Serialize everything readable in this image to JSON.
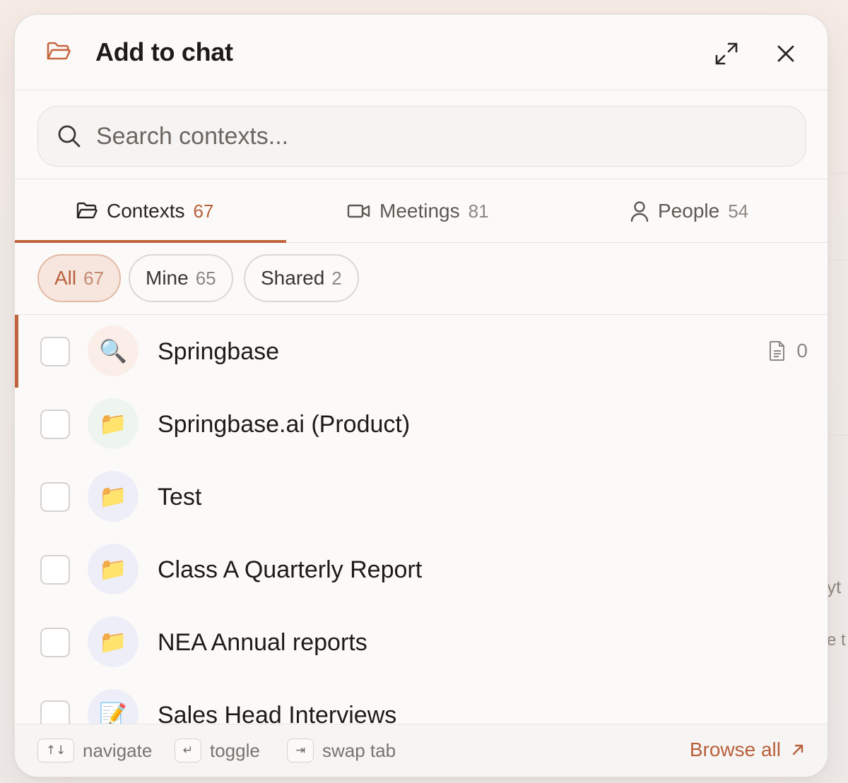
{
  "dialog": {
    "title": "Add to chat"
  },
  "search": {
    "placeholder": "Search contexts..."
  },
  "tabs": [
    {
      "label": "Contexts",
      "count": "67",
      "icon": "folder-icon",
      "active": true
    },
    {
      "label": "Meetings",
      "count": "81",
      "icon": "video-icon",
      "active": false
    },
    {
      "label": "People",
      "count": "54",
      "icon": "person-icon",
      "active": false
    }
  ],
  "filters": [
    {
      "label": "All",
      "count": "67",
      "active": true
    },
    {
      "label": "Mine",
      "count": "65",
      "active": false
    },
    {
      "label": "Shared",
      "count": "2",
      "active": false
    }
  ],
  "items": [
    {
      "name": "Springbase",
      "emoji": "🔍",
      "docs": "0",
      "selected": true
    },
    {
      "name": "Springbase.ai (Product)",
      "emoji": "📁",
      "selected": false
    },
    {
      "name": "Test",
      "emoji": "📁",
      "selected": false
    },
    {
      "name": "Class A Quarterly Report",
      "emoji": "📁",
      "selected": false
    },
    {
      "name": "NEA Annual reports",
      "emoji": "📁",
      "selected": false
    },
    {
      "name": "Sales Head Interviews",
      "emoji": "📝",
      "selected": false
    }
  ],
  "footer": {
    "navigate_key": "↑↓",
    "navigate_label": "navigate",
    "toggle_key": "↵",
    "toggle_label": "toggle",
    "swap_key": "⇥",
    "swap_label": "swap tab",
    "browse_label": "Browse all"
  },
  "background": {
    "text1": "yt",
    "text2": "e t"
  },
  "colors": {
    "accent": "#c0633c",
    "accent_text": "#b8603c",
    "panel": "#fbfaf8"
  }
}
